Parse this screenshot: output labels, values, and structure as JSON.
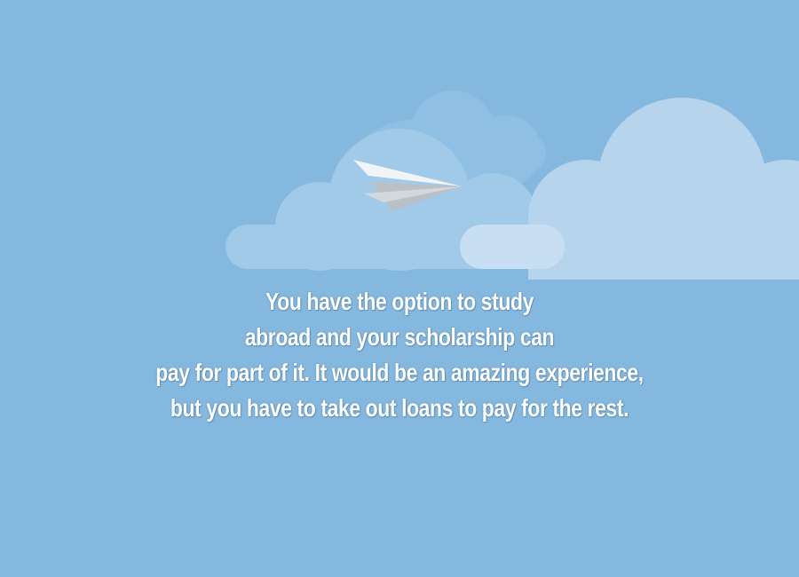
{
  "background_color": "#84b8de",
  "cloud_colors": {
    "back": "#8fc0e3",
    "middle": "#a1c9e8",
    "front": "#b6d4ec",
    "highlight": "#c8def2"
  },
  "plane_colors": {
    "top": "#f2f5f7",
    "fold": "#d3d8dc",
    "shadow": "#b9c0c6"
  },
  "illustration": {
    "icon": "paper-airplane-icon"
  },
  "story": {
    "lines": [
      "You have the option to study",
      "abroad and your scholarship can",
      "pay for part of it. It would be an amazing experience,",
      "but you have to take out loans to pay for the rest."
    ]
  }
}
